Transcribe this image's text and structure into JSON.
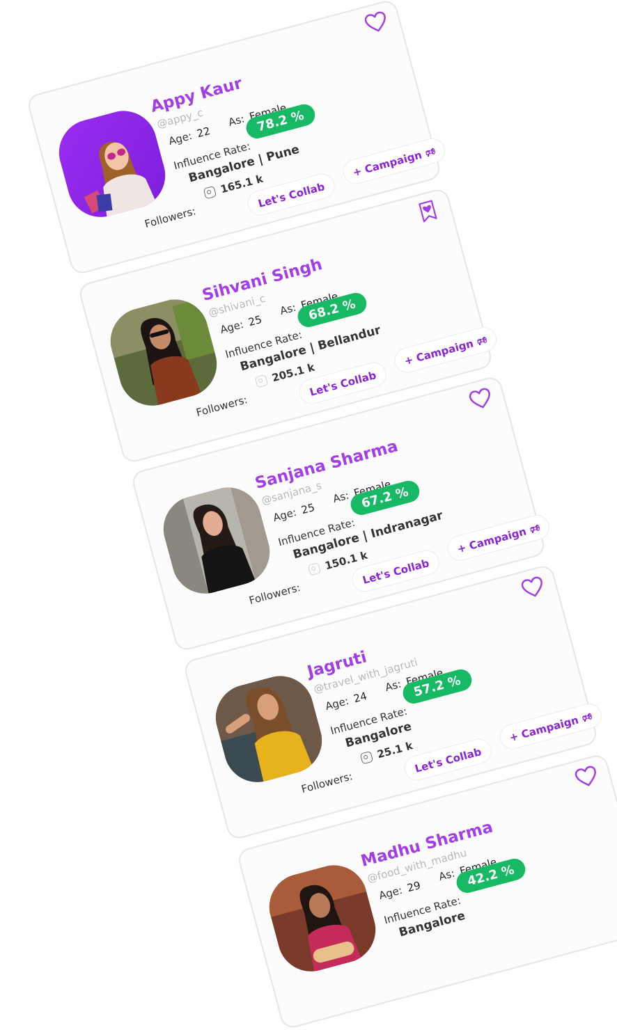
{
  "labels": {
    "age": "Age:",
    "as": "As:",
    "influence_rate": "Influence Rate:",
    "followers": "Followers:",
    "collab_button": "Let's Collab",
    "campaign_button": "+ Campaign"
  },
  "cards": [
    {
      "name": "Appy Kaur",
      "handle": "@appy_c",
      "age": "22",
      "gender": "Female",
      "rate": "78.2 %",
      "city": "Bangalore | Pune",
      "followers": "165.1 k",
      "favorite_icon": "heart-outline-icon"
    },
    {
      "name": "Sihvani Singh",
      "handle": "@shivani_c",
      "age": "25",
      "gender": "Female",
      "rate": "68.2 %",
      "city": "Bangalore | Bellandur",
      "followers": "205.1 k",
      "favorite_icon": "bookmark-heart-icon"
    },
    {
      "name": "Sanjana Sharma",
      "handle": "@sanjana_s",
      "age": "25",
      "gender": "Female",
      "rate": "67.2 %",
      "city": "Bangalore | Indranagar",
      "followers": "150.1 k",
      "favorite_icon": "heart-outline-icon"
    },
    {
      "name": "Jagruti",
      "handle": "@travel_with_jagruti",
      "age": "24",
      "gender": "Female",
      "rate": "57.2 %",
      "city": "Bangalore",
      "followers": "25.1 k",
      "favorite_icon": "heart-outline-icon"
    },
    {
      "name": "Madhu Sharma",
      "handle": "@food_with_madhu",
      "age": "29",
      "gender": "Female",
      "rate": "42.2 %",
      "city": "Bangalore",
      "followers": "",
      "favorite_icon": "heart-outline-icon"
    }
  ],
  "colors": {
    "name": "#a23ee5",
    "rate_badge": "#18b964",
    "button_text": "#8a22d8",
    "card_border": "#e6e6e6",
    "handle": "#b8b8b8"
  }
}
